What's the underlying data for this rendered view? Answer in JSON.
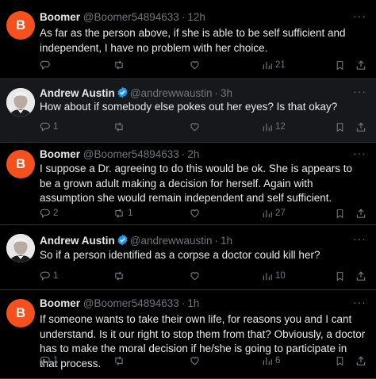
{
  "tweets": [
    {
      "avatar_letter": "B",
      "avatar_color": "#f4511e",
      "name": "Boomer",
      "handle": "@Boomer54894633",
      "separator": "·",
      "time": "12h",
      "text": "As far as the person above, if she is able to be self sufficient and independent, I have no problem with her choice.",
      "replies": "",
      "retweets": "",
      "likes": "",
      "views": "21"
    },
    {
      "avatar_letter": "",
      "name": "Andrew Austin",
      "verified": true,
      "handle": "@andrewwaustin",
      "separator": "·",
      "time": "3h",
      "text": "How about if somebody else pokes out her eyes? Is that okay?",
      "replies": "1",
      "retweets": "",
      "likes": "",
      "views": "12"
    },
    {
      "avatar_letter": "B",
      "avatar_color": "#f4511e",
      "name": "Boomer",
      "handle": "@Boomer54894633",
      "separator": "·",
      "time": "2h",
      "text": "I suppose a Dr. agreeing to do this would be ok.  She is appears to be a grown adult making a decision for herself.  Again with assumption she would remain independent and self sufficient.",
      "replies": "2",
      "retweets": "1",
      "likes": "",
      "views": "27"
    },
    {
      "avatar_letter": "",
      "name": "Andrew Austin",
      "verified": true,
      "handle": "@andrewwaustin",
      "separator": "·",
      "time": "1h",
      "text": "So if a person identified as a corpse a doctor could kill her?",
      "replies": "1",
      "retweets": "",
      "likes": "",
      "views": "10"
    },
    {
      "avatar_letter": "B",
      "avatar_color": "#f4511e",
      "name": "Boomer",
      "handle": "@Boomer54894633",
      "separator": "·",
      "time": "1h",
      "text": "If someone wants to take their own life, for reasons you and I cant understand.  Is it our right to stop them from that?  Obviously, a doctor has to make the moral decision if he/she is going to participate in that process.",
      "replies": "1",
      "retweets": "",
      "likes": "",
      "views": "6"
    }
  ],
  "colors": {
    "background": "#000000",
    "text": "#e7e9ea",
    "muted": "#71767b",
    "verified": "#1d9bf0",
    "divider": "#2f3336"
  },
  "icons": [
    "reply-icon",
    "retweet-icon",
    "like-icon",
    "views-icon",
    "bookmark-icon",
    "share-icon",
    "more-icon",
    "verified-badge-icon"
  ]
}
